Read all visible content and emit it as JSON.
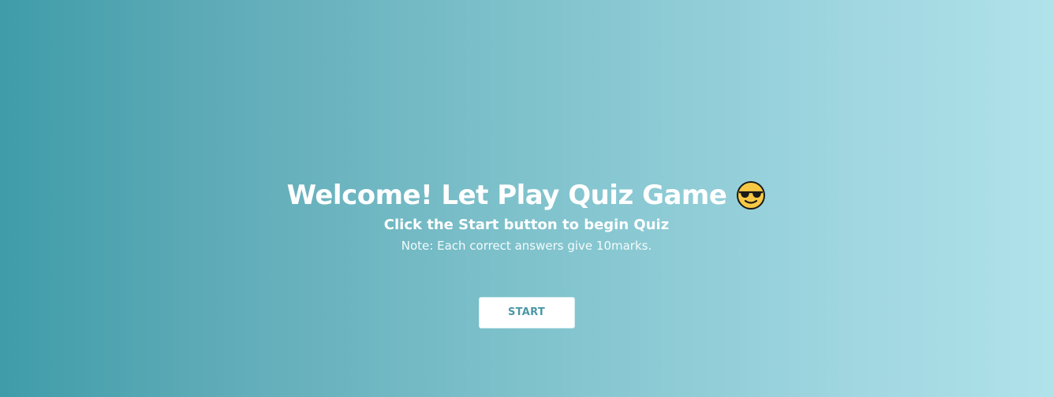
{
  "welcome": {
    "title": "Welcome! Let Play Quiz Game",
    "title_emoji_icon": "smiling-face-with-sunglasses-icon",
    "subtitle": "Click the Start button to begin Quiz",
    "note": "Note: Each correct answers give 10marks."
  },
  "actions": {
    "start_label": "START"
  },
  "colors": {
    "gradient_start": "#3f9ca9",
    "gradient_end": "#b0e2ea",
    "button_text": "#4a98a4",
    "button_bg": "#ffffff"
  }
}
